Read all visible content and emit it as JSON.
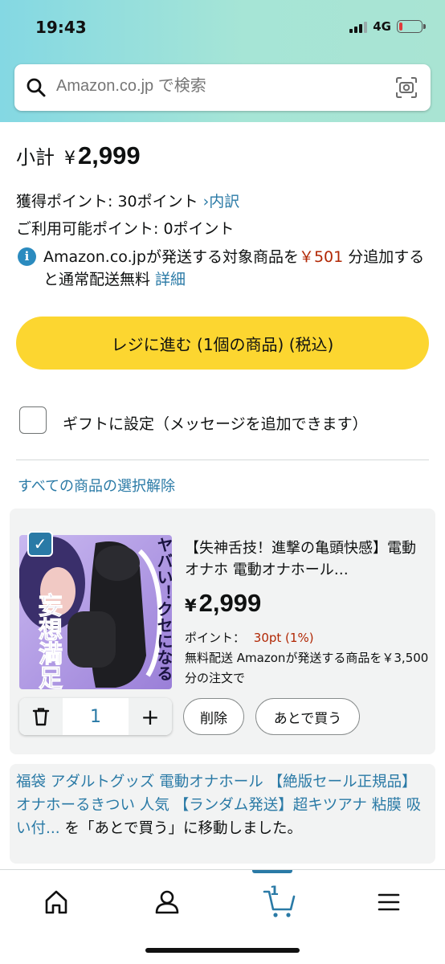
{
  "status_bar": {
    "time": "19:43",
    "network": "4G"
  },
  "search": {
    "placeholder": "Amazon.co.jp で検索"
  },
  "summary": {
    "subtotal_label": "小計",
    "currency": "¥",
    "subtotal_amount": "2,999",
    "earned_points": "獲得ポイント: 30ポイント",
    "points_detail_link": "›内訳",
    "available_points": "ご利用可能ポイント: 0ポイント",
    "shipping_prefix": "Amazon.co.jpが発送する対象商品を",
    "shipping_amount": "￥501",
    "shipping_suffix": " 分追加すると通常配送無料 ",
    "shipping_details_link": "詳細"
  },
  "checkout_button": "レジに進む (1個の商品) (税込)",
  "gift_option": "ギフトに設定（メッセージを追加できます）",
  "deselect_all": "すべての商品の選択解除",
  "cart_item": {
    "title": "【失神舌技！進撃の亀頭快感】電動オナホ 電動オナホール…",
    "price_currency": "¥",
    "price": "2,999",
    "points_label": "ポイント：",
    "points_value": "30pt (1%)",
    "shipping_note": "無料配送 Amazonが発送する商品を￥3,500分の注文で",
    "quantity": "1",
    "delete_label": "削除",
    "save_later_label": "あとで買う",
    "image_text_vertical": "ヤバい！クセになる",
    "image_text_main": "妄想満足"
  },
  "notice": {
    "item_link": "福袋 アダルトグッズ 電動オナホール 【絶版セール正規品】 オナホーるきつい 人気 【ランダム発送】超キツアナ 粘膜 吸い付...",
    "message": " を「あとで買う」に移動しました。"
  },
  "bottom_nav": {
    "cart_count": "1",
    "items": [
      "home-icon",
      "account-icon",
      "cart-icon",
      "menu-icon"
    ]
  },
  "colors": {
    "header_gradient_start": "#84d8e3",
    "header_gradient_end": "#a9e4d3",
    "checkout_yellow": "#fcd630",
    "link_blue": "#2a7aa6",
    "price_red": "#b12704"
  }
}
